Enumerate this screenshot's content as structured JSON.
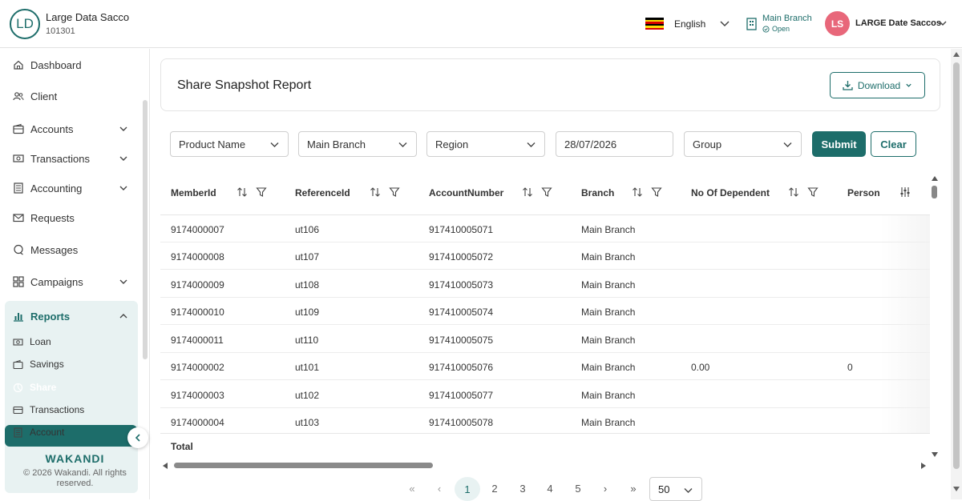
{
  "org": {
    "initials": "LD",
    "name": "Large Data Sacco",
    "id": "101301"
  },
  "header": {
    "language": "English",
    "branch": "Main Branch",
    "branch_status": "Open",
    "user_initials": "LS",
    "user_name": "LARGE Date Saccos"
  },
  "sidebar": {
    "items": [
      {
        "label": "Dashboard",
        "icon": "home-icon"
      },
      {
        "label": "Client",
        "icon": "users-icon"
      },
      {
        "label": "Accounts",
        "icon": "wallet-icon"
      },
      {
        "label": "Transactions",
        "icon": "cash-icon"
      },
      {
        "label": "Accounting",
        "icon": "ledger-icon"
      },
      {
        "label": "Requests",
        "icon": "mail-icon"
      },
      {
        "label": "Messages",
        "icon": "chat-icon"
      },
      {
        "label": "Campaigns",
        "icon": "grid-icon"
      },
      {
        "label": "Reports",
        "icon": "bar-chart-icon"
      }
    ],
    "report_items": [
      {
        "label": "Loan",
        "icon": "cash-icon"
      },
      {
        "label": "Savings",
        "icon": "wallet-icon"
      },
      {
        "label": "Share",
        "icon": "pie-icon"
      },
      {
        "label": "Transactions",
        "icon": "card-icon"
      },
      {
        "label": "Account",
        "icon": "ledger-icon"
      }
    ],
    "brand": "WAKANDI",
    "copyright": "© 2026 Wakandi. All rights reserved."
  },
  "page": {
    "title": "Share Snapshot Report",
    "download_label": "Download"
  },
  "filters": {
    "product": "Product Name",
    "branch": "Main Branch",
    "region": "Region",
    "date": "28/07/2026",
    "group": "Group",
    "submit": "Submit",
    "clear": "Clear"
  },
  "table": {
    "columns": [
      "MemberId",
      "ReferenceId",
      "AccountNumber",
      "Branch",
      "No Of Dependent",
      "Person"
    ],
    "rows": [
      [
        "9174000007",
        "ut106",
        "917410005071",
        "Main Branch",
        "",
        ""
      ],
      [
        "9174000008",
        "ut107",
        "917410005072",
        "Main Branch",
        "",
        ""
      ],
      [
        "9174000009",
        "ut108",
        "917410005073",
        "Main Branch",
        "",
        ""
      ],
      [
        "9174000010",
        "ut109",
        "917410005074",
        "Main Branch",
        "",
        ""
      ],
      [
        "9174000011",
        "ut110",
        "917410005075",
        "Main Branch",
        "",
        ""
      ],
      [
        "9174000002",
        "ut101",
        "917410005076",
        "Main Branch",
        "0.00",
        "0"
      ],
      [
        "9174000003",
        "ut102",
        "917410005077",
        "Main Branch",
        "",
        ""
      ],
      [
        "9174000004",
        "ut103",
        "917410005078",
        "Main Branch",
        "",
        ""
      ]
    ],
    "total_label": "Total"
  },
  "pagination": {
    "first": "«",
    "prev": "‹",
    "pages": [
      "1",
      "2",
      "3",
      "4",
      "5"
    ],
    "next": "›",
    "last": "»",
    "per_page": "50",
    "current": "1"
  },
  "colors": {
    "accent": "#1d6d6a",
    "avatar": "#e8677a",
    "active_bg": "#e8f2f2"
  }
}
